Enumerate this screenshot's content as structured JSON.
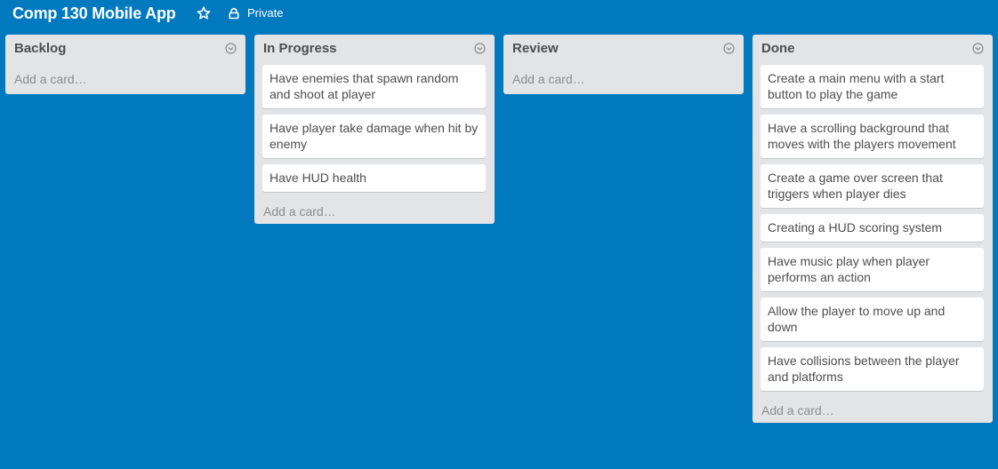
{
  "board": {
    "title": "Comp 130 Mobile App",
    "visibility": "Private",
    "background_color": "#0079bf",
    "star_icon": "star-outline-icon",
    "lock_icon": "lock-icon"
  },
  "add_card_label": "Add a card…",
  "lists": [
    {
      "title": "Backlog",
      "cards": []
    },
    {
      "title": "In Progress",
      "cards": [
        "Have enemies that spawn random and shoot at player",
        "Have player take damage when hit by enemy",
        "Have HUD health"
      ]
    },
    {
      "title": "Review",
      "cards": []
    },
    {
      "title": "Done",
      "cards": [
        "Create a main menu with a start button to play the game",
        "Have a scrolling background that moves with the players movement",
        "Create a game over screen that triggers when player dies",
        "Creating a HUD scoring system",
        "Have music play when player performs an action",
        "Allow the player to move up and down",
        "Have collisions between the player and platforms"
      ]
    }
  ]
}
